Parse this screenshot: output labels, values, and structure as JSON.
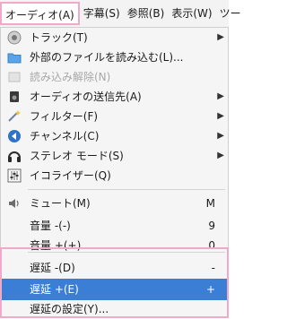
{
  "menubar": {
    "items": [
      {
        "label": "オーディオ(A)"
      },
      {
        "label": "字幕(S)"
      },
      {
        "label": "参照(B)"
      },
      {
        "label": "表示(W)"
      },
      {
        "label": "ツー"
      }
    ]
  },
  "menu": {
    "items": [
      {
        "label": "トラック(T)",
        "icon": "speaker-icon"
      },
      {
        "label": "外部のファイルを読み込む(L)...",
        "icon": "folder-icon"
      },
      {
        "label": "読み込み解除(N)",
        "icon": "unload-icon"
      },
      {
        "label": "オーディオの送信先(A)",
        "icon": "device-icon"
      },
      {
        "label": "フィルター(F)",
        "icon": "filter-wand-icon"
      },
      {
        "label": "チャンネル(C)",
        "icon": "channel-icon"
      },
      {
        "label": "ステレオ モード(S)",
        "icon": "headphones-icon"
      },
      {
        "label": "イコライザー(Q)",
        "icon": "equalizer-icon"
      },
      {
        "label": "ミュート(M)",
        "shortcut": "M",
        "icon": "volume-icon"
      },
      {
        "label": "音量 -(-)",
        "shortcut": "9"
      },
      {
        "label": "音量 +(+)",
        "shortcut": "0"
      },
      {
        "label": "遅延 -(D)",
        "shortcut": "-"
      },
      {
        "label": "遅延 +(E)",
        "shortcut": "+"
      },
      {
        "label": "遅延の設定(Y)..."
      }
    ]
  },
  "colors": {
    "highlight": "#3a7fd5",
    "annotation_box": "#f0a9c6"
  }
}
